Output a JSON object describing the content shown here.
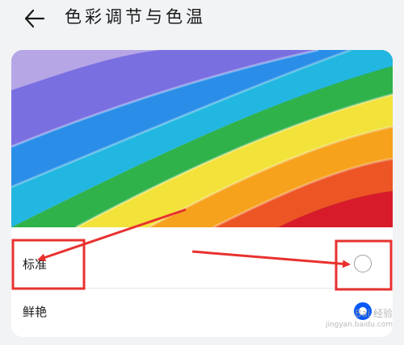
{
  "header": {
    "title": "色彩调节与色温",
    "back_icon": "arrow-left-icon"
  },
  "preview": {
    "description_icon": "rainbow-wave-preview"
  },
  "options": [
    {
      "label": "标准",
      "selected": false
    },
    {
      "label": "鲜艳",
      "selected": true
    }
  ],
  "colors": {
    "background": "#f1f3f5",
    "card": "#ffffff",
    "accent": "#0a59f7",
    "annotation": "#e8312f"
  },
  "watermark": {
    "brand": "Bai 经验",
    "url": "jingyan.baidu.com"
  }
}
